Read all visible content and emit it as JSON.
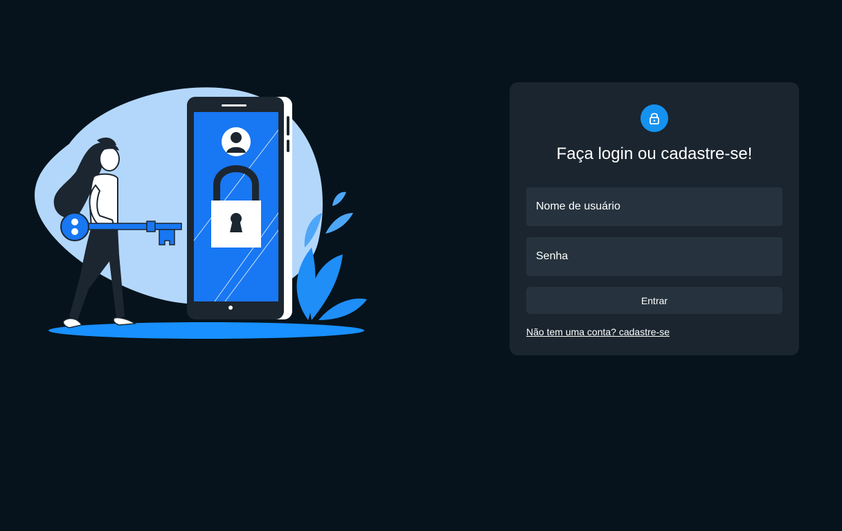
{
  "login": {
    "title": "Faça login ou cadastre-se!",
    "username_placeholder": "Nome de usuário",
    "password_placeholder": "Senha",
    "submit_label": "Entrar",
    "signup_link": "Não tem uma conta? cadastre-se"
  },
  "icons": {
    "badge": "lock-icon",
    "illustration": "woman-with-key-and-locked-phone"
  },
  "colors": {
    "background": "#06131c",
    "card": "#1a252f",
    "field": "#26333e",
    "accent": "#1592f0",
    "illustration_blue": "#1877f2",
    "illustration_light_blue": "#a9d3fb"
  }
}
